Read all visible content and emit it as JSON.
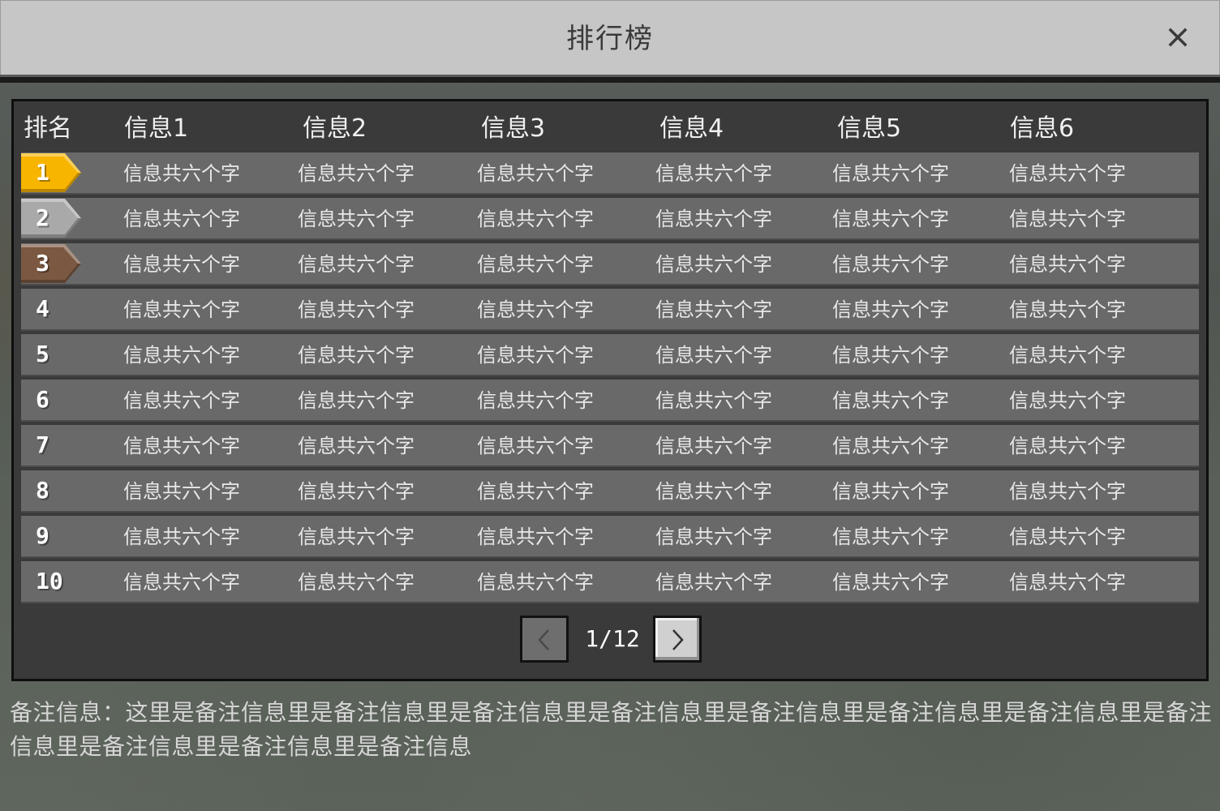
{
  "window": {
    "title": "排行榜",
    "close_icon": "close-icon"
  },
  "table": {
    "headers": [
      "排名",
      "信息1",
      "信息2",
      "信息3",
      "信息4",
      "信息5",
      "信息6"
    ],
    "rows": [
      {
        "rank": "1",
        "badge": "gold",
        "cells": [
          "信息共六个字",
          "信息共六个字",
          "信息共六个字",
          "信息共六个字",
          "信息共六个字",
          "信息共六个字"
        ]
      },
      {
        "rank": "2",
        "badge": "silver",
        "cells": [
          "信息共六个字",
          "信息共六个字",
          "信息共六个字",
          "信息共六个字",
          "信息共六个字",
          "信息共六个字"
        ]
      },
      {
        "rank": "3",
        "badge": "bronze",
        "cells": [
          "信息共六个字",
          "信息共六个字",
          "信息共六个字",
          "信息共六个字",
          "信息共六个字",
          "信息共六个字"
        ]
      },
      {
        "rank": "4",
        "badge": "",
        "cells": [
          "信息共六个字",
          "信息共六个字",
          "信息共六个字",
          "信息共六个字",
          "信息共六个字",
          "信息共六个字"
        ]
      },
      {
        "rank": "5",
        "badge": "",
        "cells": [
          "信息共六个字",
          "信息共六个字",
          "信息共六个字",
          "信息共六个字",
          "信息共六个字",
          "信息共六个字"
        ]
      },
      {
        "rank": "6",
        "badge": "",
        "cells": [
          "信息共六个字",
          "信息共六个字",
          "信息共六个字",
          "信息共六个字",
          "信息共六个字",
          "信息共六个字"
        ]
      },
      {
        "rank": "7",
        "badge": "",
        "cells": [
          "信息共六个字",
          "信息共六个字",
          "信息共六个字",
          "信息共六个字",
          "信息共六个字",
          "信息共六个字"
        ]
      },
      {
        "rank": "8",
        "badge": "",
        "cells": [
          "信息共六个字",
          "信息共六个字",
          "信息共六个字",
          "信息共六个字",
          "信息共六个字",
          "信息共六个字"
        ]
      },
      {
        "rank": "9",
        "badge": "",
        "cells": [
          "信息共六个字",
          "信息共六个字",
          "信息共六个字",
          "信息共六个字",
          "信息共六个字",
          "信息共六个字"
        ]
      },
      {
        "rank": "10",
        "badge": "",
        "cells": [
          "信息共六个字",
          "信息共六个字",
          "信息共六个字",
          "信息共六个字",
          "信息共六个字",
          "信息共六个字"
        ]
      }
    ]
  },
  "pager": {
    "current_page": 1,
    "total_pages": 12,
    "label": "1/12",
    "prev_icon": "chevron-left-icon",
    "next_icon": "chevron-right-icon"
  },
  "note": "备注信息：这里是备注信息里是备注信息里是备注信息里是备注信息里是备注信息里是备注信息里是备注信息里是备注信息里是备注信息里是备注信息里是备注信息",
  "colors": {
    "gold": "#f7b500",
    "silver": "#a9a9a9",
    "bronze": "#7b5841",
    "row_bg": "#696969",
    "panel_bg": "#3a3a3a",
    "title_bar_bg": "#c6c6c6"
  }
}
